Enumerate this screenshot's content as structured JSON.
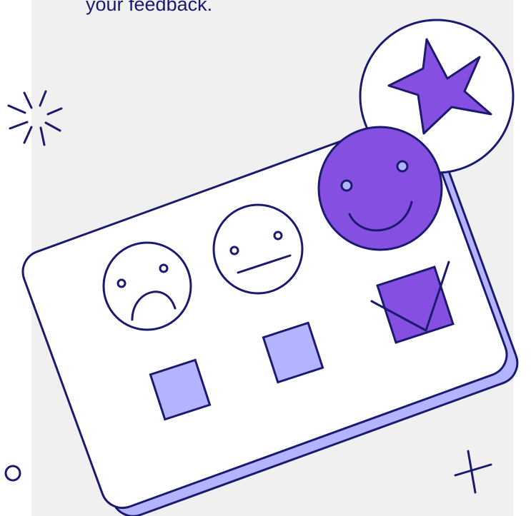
{
  "caption": "your feedback.",
  "colors": {
    "background": "#ffffff",
    "panel": "#f0f0f0",
    "ink": "#1a1a6e",
    "accent": "#8550e2",
    "lavender": "#b3b3ff",
    "card": "#ffffff"
  },
  "icons": {
    "sad_face": "sad-face-icon",
    "neutral_face": "neutral-face-icon",
    "happy_face": "happy-face-icon",
    "star": "star-icon",
    "checkbox_checked": "checkbox-checked-icon",
    "checkbox_empty": "checkbox-empty-icon",
    "sparkle": "sparkle-icon",
    "plus": "plus-icon",
    "ring": "ring-icon"
  },
  "rating": {
    "selected_option": 3,
    "option_count": 3
  }
}
